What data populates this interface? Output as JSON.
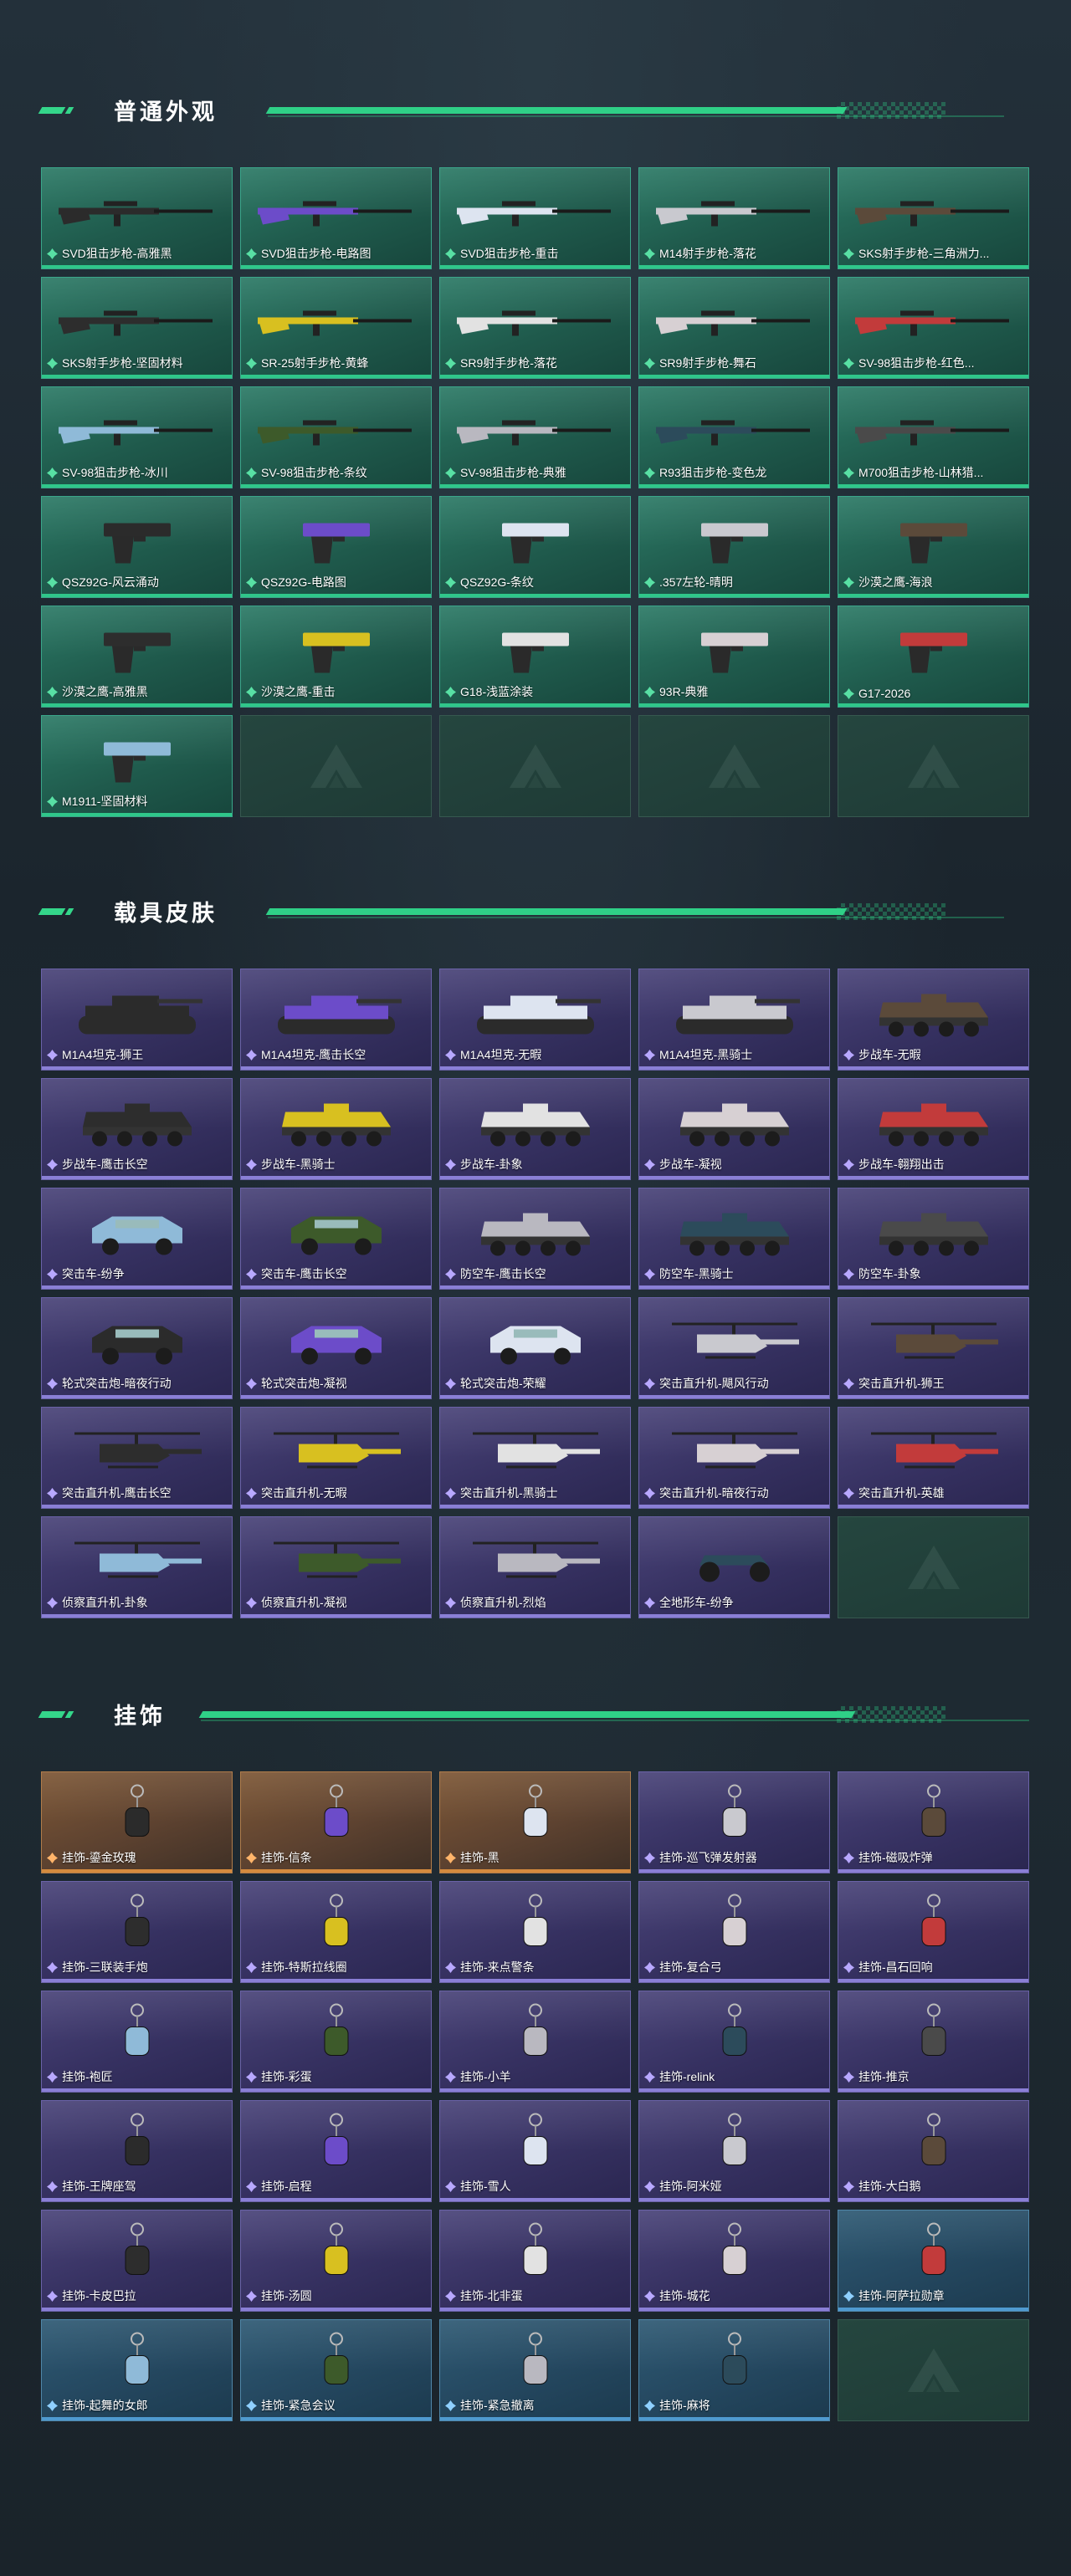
{
  "colors": {
    "accent": "#2fd087",
    "green_card": "#1f5a4c",
    "purple_card": "#363161",
    "orange_card": "#5d4230",
    "blue_card": "#24475f"
  },
  "sections": {
    "weapons": {
      "title": "普通外观",
      "items": [
        {
          "label": "SVD狙击步枪-高雅黑",
          "art": "rifle"
        },
        {
          "label": "SVD狙击步枪-电路图",
          "art": "rifle"
        },
        {
          "label": "SVD狙击步枪-重击",
          "art": "rifle"
        },
        {
          "label": "M14射手步枪-落花",
          "art": "rifle"
        },
        {
          "label": "SKS射手步枪-三角洲力...",
          "art": "rifle"
        },
        {
          "label": "SKS射手步枪-坚固材料",
          "art": "rifle"
        },
        {
          "label": "SR-25射手步枪-黄蜂",
          "art": "rifle"
        },
        {
          "label": "SR9射手步枪-落花",
          "art": "rifle"
        },
        {
          "label": "SR9射手步枪-舞石",
          "art": "rifle"
        },
        {
          "label": "SV-98狙击步枪-红色...",
          "art": "rifle"
        },
        {
          "label": "SV-98狙击步枪-冰川",
          "art": "rifle"
        },
        {
          "label": "SV-98狙击步枪-条纹",
          "art": "rifle"
        },
        {
          "label": "SV-98狙击步枪-典雅",
          "art": "rifle"
        },
        {
          "label": "R93狙击步枪-变色龙",
          "art": "rifle"
        },
        {
          "label": "M700狙击步枪-山林猎...",
          "art": "rifle"
        },
        {
          "label": "QSZ92G-风云涌动",
          "art": "pistol"
        },
        {
          "label": "QSZ92G-电路图",
          "art": "pistol"
        },
        {
          "label": "QSZ92G-条纹",
          "art": "pistol"
        },
        {
          "label": ".357左轮-晴明",
          "art": "pistol"
        },
        {
          "label": "沙漠之鹰-海浪",
          "art": "pistol"
        },
        {
          "label": "沙漠之鹰-高雅黑",
          "art": "pistol"
        },
        {
          "label": "沙漠之鹰-重击",
          "art": "pistol"
        },
        {
          "label": "G18-浅蓝涂装",
          "art": "pistol"
        },
        {
          "label": "93R-典雅",
          "art": "pistol"
        },
        {
          "label": "G17-2026",
          "art": "pistol"
        },
        {
          "label": "M1911-坚固材料",
          "art": "pistol"
        }
      ]
    },
    "vehicles": {
      "title": "载具皮肤",
      "items": [
        {
          "label": "M1A4坦克-狮王",
          "art": "tank"
        },
        {
          "label": "M1A4坦克-鹰击长空",
          "art": "tank"
        },
        {
          "label": "M1A4坦克-无暇",
          "art": "tank"
        },
        {
          "label": "M1A4坦克-黑骑士",
          "art": "tank"
        },
        {
          "label": "步战车-无暇",
          "art": "apc"
        },
        {
          "label": "步战车-鹰击长空",
          "art": "apc"
        },
        {
          "label": "步战车-黑骑士",
          "art": "apc"
        },
        {
          "label": "步战车-卦象",
          "art": "apc"
        },
        {
          "label": "步战车-凝视",
          "art": "apc"
        },
        {
          "label": "步战车-翱翔出击",
          "art": "apc"
        },
        {
          "label": "突击车-纷争",
          "art": "car"
        },
        {
          "label": "突击车-鹰击长空",
          "art": "car"
        },
        {
          "label": "防空车-鹰击长空",
          "art": "apc"
        },
        {
          "label": "防空车-黑骑士",
          "art": "apc"
        },
        {
          "label": "防空车-卦象",
          "art": "apc"
        },
        {
          "label": "轮式突击炮-暗夜行动",
          "art": "car"
        },
        {
          "label": "轮式突击炮-凝视",
          "art": "car"
        },
        {
          "label": "轮式突击炮-荣耀",
          "art": "car"
        },
        {
          "label": "突击直升机-飓风行动",
          "art": "heli"
        },
        {
          "label": "突击直升机-狮王",
          "art": "heli"
        },
        {
          "label": "突击直升机-鹰击长空",
          "art": "heli"
        },
        {
          "label": "突击直升机-无暇",
          "art": "heli"
        },
        {
          "label": "突击直升机-黑骑士",
          "art": "heli"
        },
        {
          "label": "突击直升机-暗夜行动",
          "art": "heli"
        },
        {
          "label": "突击直升机-英雄",
          "art": "heli"
        },
        {
          "label": "侦察直升机-卦象",
          "art": "heli"
        },
        {
          "label": "侦察直升机-凝视",
          "art": "heli"
        },
        {
          "label": "侦察直升机-烈焰",
          "art": "heli"
        },
        {
          "label": "全地形车-纷争",
          "art": "atv"
        }
      ]
    },
    "charms": {
      "title": "挂饰",
      "items": [
        {
          "label": "挂饰-鎏金玫瑰",
          "tier": "orange"
        },
        {
          "label": "挂饰-信条",
          "tier": "orange"
        },
        {
          "label": "挂饰-黑",
          "tier": "orange"
        },
        {
          "label": "挂饰-巡飞弹发射器",
          "tier": "purple"
        },
        {
          "label": "挂饰-磁吸炸弹",
          "tier": "purple"
        },
        {
          "label": "挂饰-三联装手炮",
          "tier": "purple"
        },
        {
          "label": "挂饰-特斯拉线圈",
          "tier": "purple"
        },
        {
          "label": "挂饰-来点警条",
          "tier": "purple"
        },
        {
          "label": "挂饰-复合弓",
          "tier": "purple"
        },
        {
          "label": "挂饰-昌石回响",
          "tier": "purple"
        },
        {
          "label": "挂饰-袍匠",
          "tier": "purple"
        },
        {
          "label": "挂饰-彩蛋",
          "tier": "purple"
        },
        {
          "label": "挂饰-小羊",
          "tier": "purple"
        },
        {
          "label": "挂饰-relink",
          "tier": "purple"
        },
        {
          "label": "挂饰-推京",
          "tier": "purple"
        },
        {
          "label": "挂饰-王牌座驾",
          "tier": "purple"
        },
        {
          "label": "挂饰-启程",
          "tier": "purple"
        },
        {
          "label": "挂饰-雪人",
          "tier": "purple"
        },
        {
          "label": "挂饰-阿米娅",
          "tier": "purple"
        },
        {
          "label": "挂饰-大白鹅",
          "tier": "purple"
        },
        {
          "label": "挂饰-卡皮巴拉",
          "tier": "purple"
        },
        {
          "label": "挂饰-汤圆",
          "tier": "purple"
        },
        {
          "label": "挂饰-北非蛋",
          "tier": "purple"
        },
        {
          "label": "挂饰-城花",
          "tier": "purple"
        },
        {
          "label": "挂饰-阿萨拉勋章",
          "tier": "blue"
        },
        {
          "label": "挂饰-起舞的女郎",
          "tier": "blue"
        },
        {
          "label": "挂饰-紧急会议",
          "tier": "blue"
        },
        {
          "label": "挂饰-紧急撤离",
          "tier": "blue"
        },
        {
          "label": "挂饰-麻将",
          "tier": "blue"
        }
      ]
    }
  }
}
